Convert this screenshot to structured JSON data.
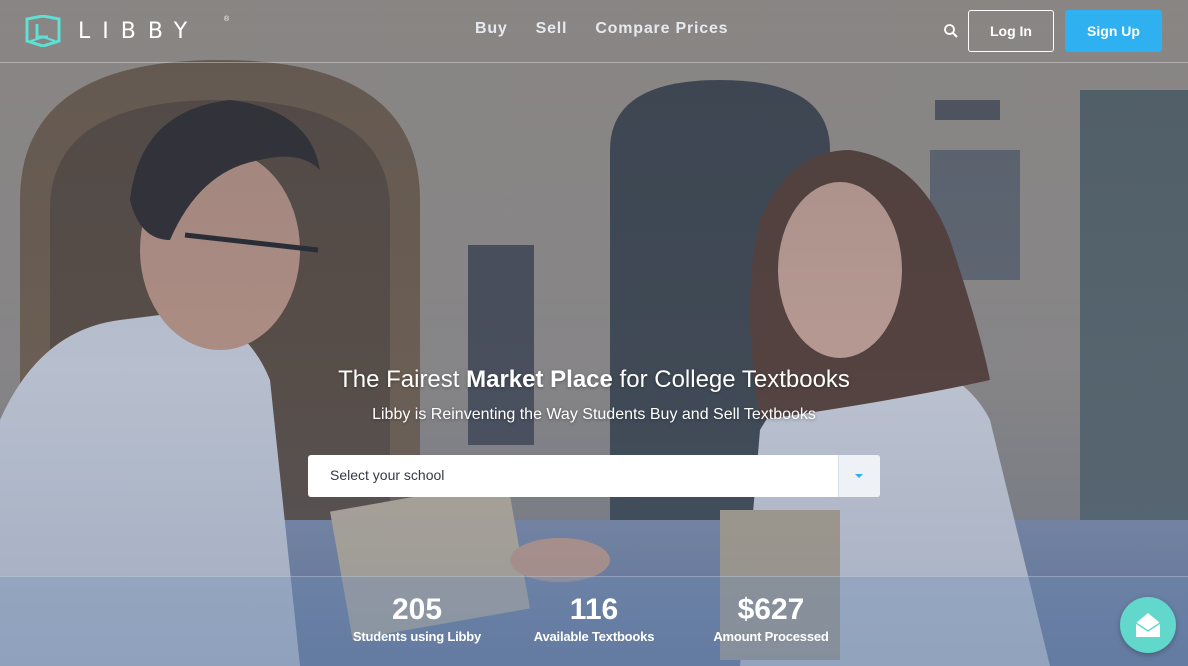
{
  "brand": {
    "name": "LIBBY",
    "registered_mark": "®",
    "accent_color": "#5ee0d4"
  },
  "nav": {
    "links": [
      {
        "label": "Buy"
      },
      {
        "label": "Sell"
      },
      {
        "label": "Compare Prices"
      }
    ],
    "search_icon": "search-icon",
    "login_label": "Log In",
    "signup_label": "Sign Up",
    "signup_color": "#2fb0f0"
  },
  "hero": {
    "headline_part1": "The Fairest ",
    "headline_part2": "Market Place",
    "headline_part3": " for College Textbooks",
    "subheadline": "Libby is Reinventing the Way Students Buy and Sell Textbooks",
    "school_select": {
      "placeholder": "Select your school",
      "icon": "chevron-down-icon"
    }
  },
  "stats": [
    {
      "value": "205",
      "label": "Students using Libby"
    },
    {
      "value": "116",
      "label": "Available Textbooks"
    },
    {
      "value": "$627",
      "label": "Amount Processed"
    }
  ],
  "chat_widget": {
    "icon": "envelope-icon",
    "color": "#62d8cc"
  }
}
